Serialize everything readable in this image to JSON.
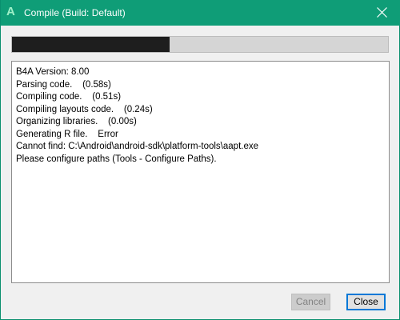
{
  "window": {
    "title": "Compile (Build: Default)",
    "app_icon_glyph": "A",
    "accent_color": "#0f9d77"
  },
  "progress": {
    "fraction": 0.42
  },
  "log": {
    "lines": [
      "B4A Version: 8.00",
      "Parsing code.    (0.58s)",
      "Compiling code.    (0.51s)",
      "Compiling layouts code.    (0.24s)",
      "Organizing libraries.    (0.00s)",
      "Generating R file.    Error",
      "Cannot find: C:\\Android\\android-sdk\\platform-tools\\aapt.exe",
      "Please configure paths (Tools - Configure Paths)."
    ]
  },
  "buttons": {
    "cancel_label": "Cancel",
    "cancel_enabled": false,
    "close_label": "Close"
  },
  "icons": {
    "app": "b4a-app-icon",
    "close": "close-icon"
  }
}
